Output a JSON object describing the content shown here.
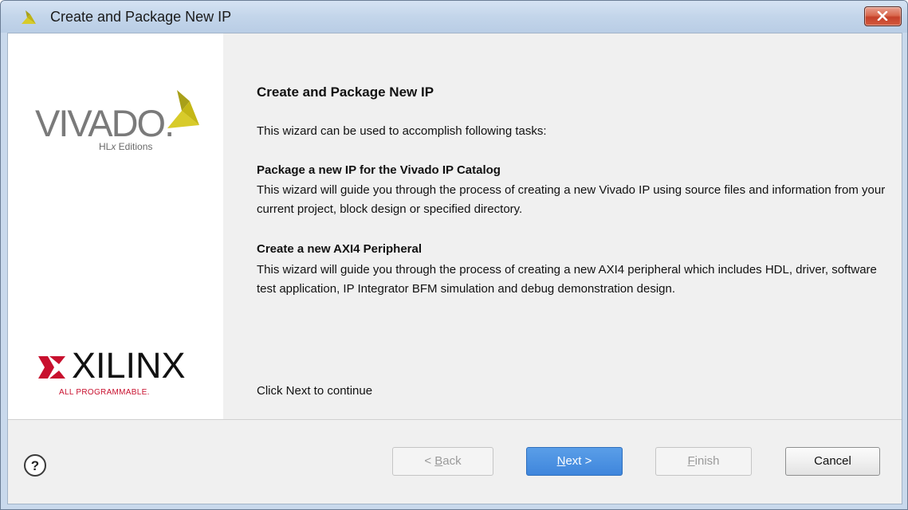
{
  "window": {
    "title": "Create and Package New IP"
  },
  "branding": {
    "vivado": "VIVADO.",
    "hlx_prefix": "HL",
    "hlx_x": "x",
    "hlx_suffix": " Editions",
    "xilinx": "XILINX",
    "all_programmable": "ALL PROGRAMMABLE."
  },
  "content": {
    "heading": "Create and Package New IP",
    "intro": "This wizard can be used to accomplish following tasks:",
    "sections": [
      {
        "title": "Package a new IP for the Vivado IP Catalog",
        "body": "This wizard will guide you through the process of creating a new Vivado IP using source files and information from your current project, block design or specified directory."
      },
      {
        "title": "Create a new AXI4 Peripheral",
        "body": "This wizard will guide you through the process of creating a new AXI4 peripheral which includes HDL, driver, software test application, IP Integrator BFM simulation and debug demonstration design."
      }
    ],
    "footer_note": "Click Next to continue"
  },
  "buttons": {
    "help_glyph": "?",
    "back_prefix": "< ",
    "back_key": "B",
    "back_rest": "ack",
    "next_key": "N",
    "next_rest": "ext >",
    "finish_key": "F",
    "finish_rest": "inish",
    "cancel": "Cancel"
  },
  "colors": {
    "primary_button": "#3f86dc",
    "title_bar": "#c3d5ea",
    "close_button": "#c5412a",
    "xilinx_red": "#c8102e",
    "vivado_leaf": "#c4b716"
  }
}
